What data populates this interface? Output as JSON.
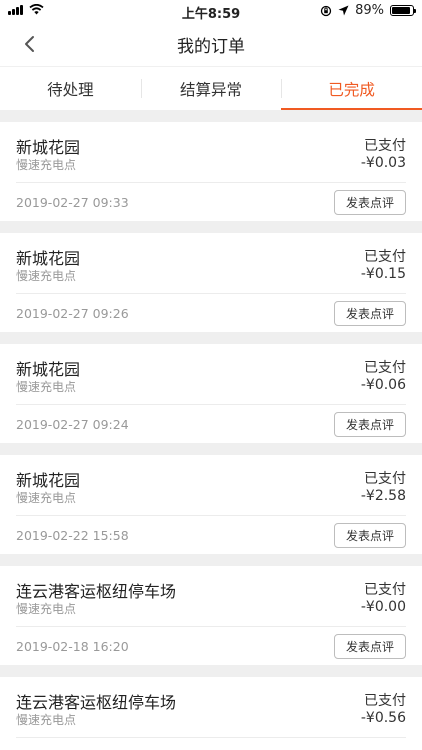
{
  "status_bar": {
    "time": "上午8:59",
    "battery": "89%",
    "battery_level": 0.89
  },
  "nav": {
    "title": "我的订单"
  },
  "tabs": [
    {
      "label": "待处理",
      "active": false
    },
    {
      "label": "结算异常",
      "active": false
    },
    {
      "label": "已完成",
      "active": true
    }
  ],
  "orders": [
    {
      "station": "新城花园",
      "type": "慢速充电点",
      "status": "已支付",
      "amount": "-¥0.03",
      "date": "2019-02-27 09:33",
      "action": "发表点评"
    },
    {
      "station": "新城花园",
      "type": "慢速充电点",
      "status": "已支付",
      "amount": "-¥0.15",
      "date": "2019-02-27 09:26",
      "action": "发表点评"
    },
    {
      "station": "新城花园",
      "type": "慢速充电点",
      "status": "已支付",
      "amount": "-¥0.06",
      "date": "2019-02-27 09:24",
      "action": "发表点评"
    },
    {
      "station": "新城花园",
      "type": "慢速充电点",
      "status": "已支付",
      "amount": "-¥2.58",
      "date": "2019-02-22 15:58",
      "action": "发表点评"
    },
    {
      "station": "连云港客运枢纽停车场",
      "type": "慢速充电点",
      "status": "已支付",
      "amount": "-¥0.00",
      "date": "2019-02-18 16:20",
      "action": "发表点评"
    },
    {
      "station": "连云港客运枢纽停车场",
      "type": "慢速充电点",
      "status": "已支付",
      "amount": "-¥0.56",
      "date": "",
      "action": ""
    }
  ],
  "colors": {
    "accent": "#f05a22",
    "background": "#efefef"
  },
  "icons": [
    "signal-icon",
    "wifi-icon",
    "orientation-lock-icon",
    "location-arrow-icon",
    "battery-icon",
    "back-chevron-icon"
  ]
}
